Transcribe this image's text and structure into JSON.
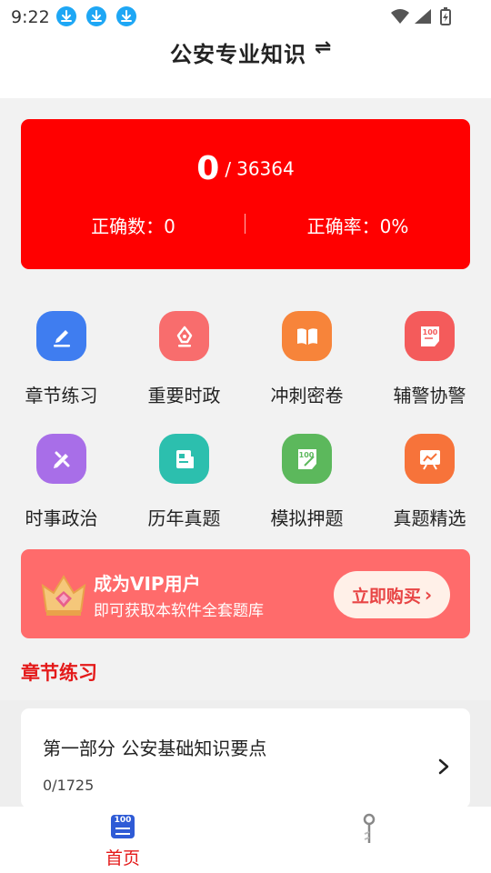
{
  "status_bar": {
    "time": "9:22"
  },
  "header": {
    "title": "公安专业知识",
    "switch_icon": "⇌"
  },
  "stats": {
    "answered": "0",
    "separator": "/",
    "total": "36364",
    "correct_label": "正确数：0",
    "rate_label": "正确率：0%"
  },
  "grid": [
    {
      "label": "章节练习",
      "icon": "pencil-line-icon",
      "color": "#3f7df0"
    },
    {
      "label": "重要时政",
      "icon": "pen-nib-icon",
      "color": "#f86d6d"
    },
    {
      "label": "冲刺密卷",
      "icon": "open-book-icon",
      "color": "#f7843a"
    },
    {
      "label": "辅警协警",
      "icon": "score-100-icon",
      "color": "#f45b5b"
    },
    {
      "label": "时事政治",
      "icon": "pencil-ruler-icon",
      "color": "#a86ee8"
    },
    {
      "label": "历年真题",
      "icon": "document-icon",
      "color": "#2cbfae"
    },
    {
      "label": "模拟押题",
      "icon": "score-100-green-icon",
      "color": "#5cb85c"
    },
    {
      "label": "真题精选",
      "icon": "chart-board-icon",
      "color": "#f7733a"
    }
  ],
  "vip": {
    "title": "成为VIP用户",
    "subtitle": "即可获取本软件全套题库",
    "button": "立即购买",
    "button_chevron": "›"
  },
  "section": {
    "title": "章节练习"
  },
  "chapter": {
    "title": "第一部分 公安基础知识要点",
    "progress": "0/1725"
  },
  "tabs": [
    {
      "label": "首页",
      "icon_text": "100",
      "active": true
    }
  ],
  "colors": {
    "primary_red": "#ff0000",
    "accent_red": "#e41a1a",
    "vip_bg": "#ff6b6b"
  }
}
